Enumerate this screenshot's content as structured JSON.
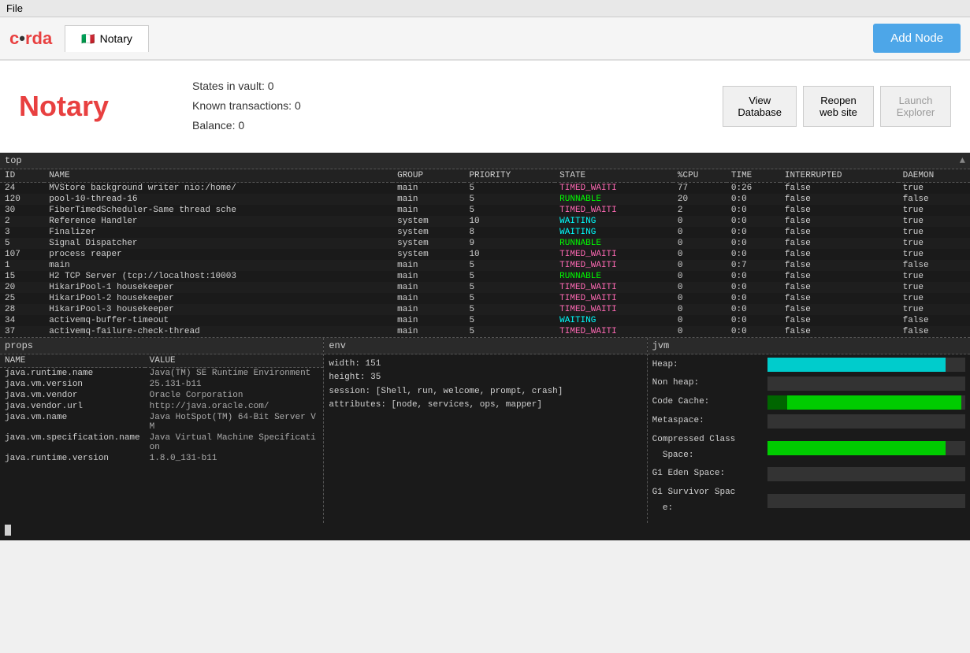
{
  "menubar": {
    "file_label": "File"
  },
  "topbar": {
    "logo": "c•rda",
    "tab_label": "Notary",
    "tab_flag": "🇮🇹",
    "add_node_label": "Add Node"
  },
  "node": {
    "title": "Notary",
    "states_label": "States in vault:",
    "states_value": "0",
    "transactions_label": "Known transactions:",
    "transactions_value": "0",
    "balance_label": "Balance:",
    "balance_value": "0",
    "btn_view_db": "View\nDatabase",
    "btn_reopen": "Reopen\nweb site",
    "btn_launch": "Launch\nExplorer"
  },
  "monitor": {
    "top_label": "top",
    "scroll_icon": "▲",
    "threads_headers": [
      "ID",
      "NAME",
      "GROUP",
      "PRIORITY",
      "STATE",
      "%CPU",
      "TIME",
      "INTERRUPTED",
      "DAEMON"
    ],
    "threads": [
      {
        "id": "24",
        "name": "MVStore background writer nio:/home/",
        "group": "main",
        "priority": "5",
        "state": "TIMED_WAITI",
        "cpu": "77",
        "time": "0:26",
        "interrupted": "false",
        "daemon": "true"
      },
      {
        "id": "120",
        "name": "pool-10-thread-16",
        "group": "main",
        "priority": "5",
        "state": "RUNNABLE",
        "cpu": "20",
        "time": "0:0",
        "interrupted": "false",
        "daemon": "false"
      },
      {
        "id": "30",
        "name": "FiberTimedScheduler-Same thread sche",
        "group": "main",
        "priority": "5",
        "state": "TIMED_WAITI",
        "cpu": "2",
        "time": "0:0",
        "interrupted": "false",
        "daemon": "true"
      },
      {
        "id": "2",
        "name": "Reference Handler",
        "group": "system",
        "priority": "10",
        "state": "WAITING",
        "cpu": "0",
        "time": "0:0",
        "interrupted": "false",
        "daemon": "true"
      },
      {
        "id": "3",
        "name": "Finalizer",
        "group": "system",
        "priority": "8",
        "state": "WAITING",
        "cpu": "0",
        "time": "0:0",
        "interrupted": "false",
        "daemon": "true"
      },
      {
        "id": "5",
        "name": "Signal Dispatcher",
        "group": "system",
        "priority": "9",
        "state": "RUNNABLE",
        "cpu": "0",
        "time": "0:0",
        "interrupted": "false",
        "daemon": "true"
      },
      {
        "id": "107",
        "name": "process reaper",
        "group": "system",
        "priority": "10",
        "state": "TIMED_WAITI",
        "cpu": "0",
        "time": "0:0",
        "interrupted": "false",
        "daemon": "true"
      },
      {
        "id": "1",
        "name": "main",
        "group": "main",
        "priority": "5",
        "state": "TIMED_WAITI",
        "cpu": "0",
        "time": "0:7",
        "interrupted": "false",
        "daemon": "false"
      },
      {
        "id": "15",
        "name": "H2 TCP Server (tcp://localhost:10003",
        "group": "main",
        "priority": "5",
        "state": "RUNNABLE",
        "cpu": "0",
        "time": "0:0",
        "interrupted": "false",
        "daemon": "true"
      },
      {
        "id": "20",
        "name": "HikariPool-1 housekeeper",
        "group": "main",
        "priority": "5",
        "state": "TIMED_WAITI",
        "cpu": "0",
        "time": "0:0",
        "interrupted": "false",
        "daemon": "true"
      },
      {
        "id": "25",
        "name": "HikariPool-2 housekeeper",
        "group": "main",
        "priority": "5",
        "state": "TIMED_WAITI",
        "cpu": "0",
        "time": "0:0",
        "interrupted": "false",
        "daemon": "true"
      },
      {
        "id": "28",
        "name": "HikariPool-3 housekeeper",
        "group": "main",
        "priority": "5",
        "state": "TIMED_WAITI",
        "cpu": "0",
        "time": "0:0",
        "interrupted": "false",
        "daemon": "true"
      },
      {
        "id": "34",
        "name": "activemq-buffer-timeout",
        "group": "main",
        "priority": "5",
        "state": "WAITING",
        "cpu": "0",
        "time": "0:0",
        "interrupted": "false",
        "daemon": "false"
      },
      {
        "id": "37",
        "name": "activemq-failure-check-thread",
        "group": "main",
        "priority": "5",
        "state": "TIMED_WAITI",
        "cpu": "0",
        "time": "0:0",
        "interrupted": "false",
        "daemon": "false"
      }
    ],
    "props_label": "props",
    "props_headers": [
      "NAME",
      "VALUE"
    ],
    "props": [
      {
        "name": "java.runtime.name",
        "value": "Java(TM) SE Runtime Environment"
      },
      {
        "name": "java.vm.version",
        "value": "25.131-b11"
      },
      {
        "name": "java.vm.vendor",
        "value": "Oracle Corporation"
      },
      {
        "name": "java.vendor.url",
        "value": "http://java.oracle.com/"
      },
      {
        "name": "java.vm.name",
        "value": "Java HotSpot(TM) 64-Bit Server VM"
      },
      {
        "name": "java.vm.specification.name",
        "value": "Java Virtual Machine Specification"
      },
      {
        "name": "java.runtime.version",
        "value": "1.8.0_131-b11"
      }
    ],
    "env_label": "env",
    "env": {
      "width": "width: 151",
      "height": "height: 35",
      "session": "session: [Shell, run, welcome, prompt, crash]",
      "attributes": "attributes: [node, services, ops, mapper]"
    },
    "jvm_label": "jvm",
    "jvm_items": [
      {
        "label": "Heap:",
        "bar_pct": 90,
        "bar_color": "cyan"
      },
      {
        "label": "Non heap:",
        "bar_pct": 0,
        "bar_color": "none"
      },
      {
        "label": "Code Cache:",
        "bar_pct_1": 10,
        "bar_pct_2": 85,
        "bar_color": "mixed"
      },
      {
        "label": "Metaspace:",
        "bar_pct": 0,
        "bar_color": "none"
      },
      {
        "label": "Compressed Class\n  Space:",
        "bar_pct": 90,
        "bar_color": "green"
      },
      {
        "label": "G1 Eden Space:",
        "bar_pct": 0,
        "bar_color": "none"
      },
      {
        "label": "G1 Survivor Spac\n  e:",
        "bar_pct": 0,
        "bar_color": "none"
      }
    ]
  }
}
